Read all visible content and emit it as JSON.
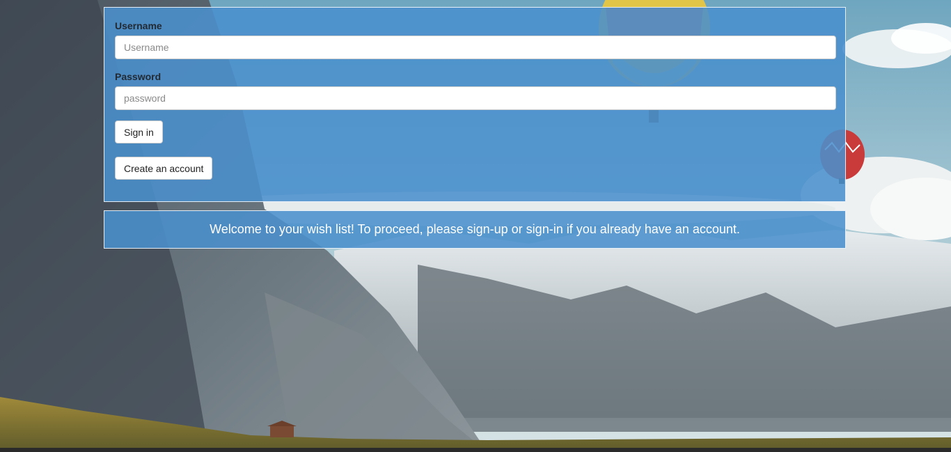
{
  "form": {
    "username_label": "Username",
    "username_placeholder": "Username",
    "username_value": "",
    "password_label": "Password",
    "password_placeholder": "password",
    "password_value": "",
    "signin_label": "Sign in",
    "create_account_label": "Create an account"
  },
  "welcome": {
    "message": "Welcome to your wish list! To proceed, please sign-up or sign-in if you already have an account."
  },
  "background": {
    "scene": "mountain-landscape-with-hot-air-balloons",
    "sky_color": "#8fb7c9",
    "accent_color": "#4a90cd"
  }
}
